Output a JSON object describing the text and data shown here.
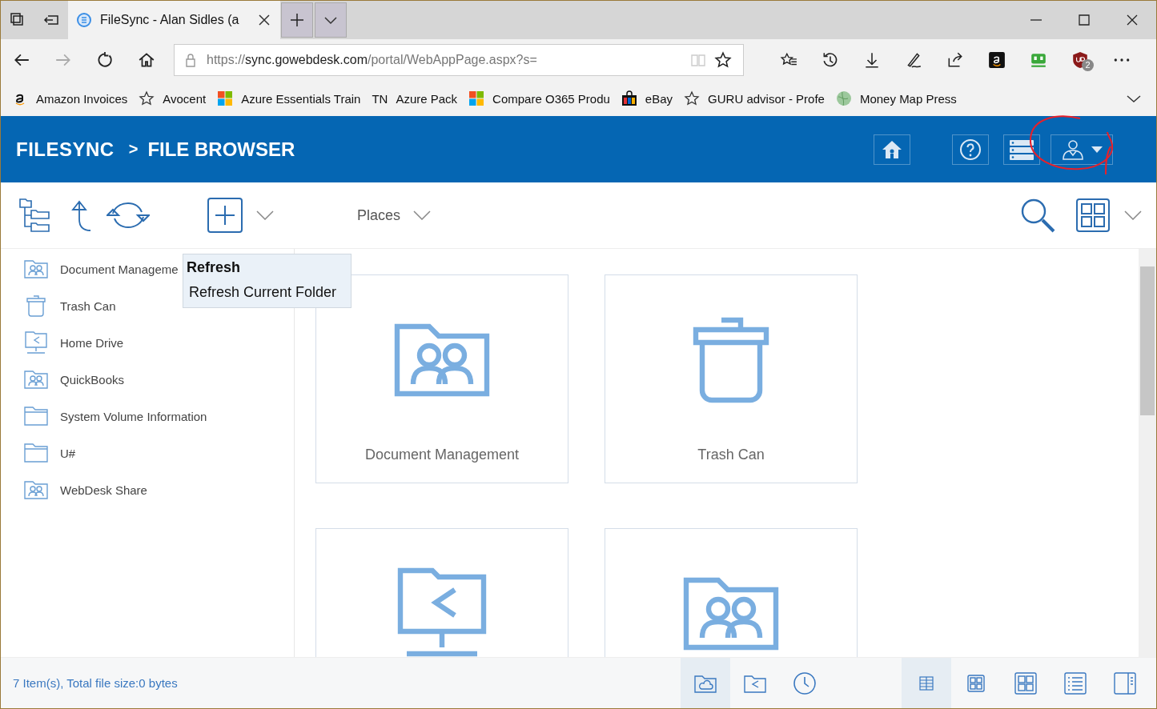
{
  "browser": {
    "tab_title": "FileSync - Alan Sidles (a",
    "url": {
      "scheme": "https://",
      "host": "sync.gowebdesk.com",
      "path": "/portal/WebAppPage.aspx?s="
    },
    "extension_badge": "2",
    "favorites": [
      {
        "kind": "amazon",
        "label": "Amazon Invoices"
      },
      {
        "kind": "star",
        "label": "Avocent"
      },
      {
        "kind": "windows",
        "label": "Azure Essentials Train"
      },
      {
        "kind": "tn",
        "label": "Azure Pack",
        "prefix": "TN"
      },
      {
        "kind": "windows",
        "label": "Compare O365 Produ"
      },
      {
        "kind": "bag",
        "label": "eBay"
      },
      {
        "kind": "star",
        "label": "GURU advisor - Profe"
      },
      {
        "kind": "globe",
        "label": "Money Map Press"
      }
    ]
  },
  "app": {
    "brand": "FILESYNC",
    "separator": ">",
    "page_title": "FILE BROWSER"
  },
  "toolbar": {
    "places": "Places"
  },
  "tooltip": {
    "title": "Refresh",
    "text": "Refresh Current Folder"
  },
  "sidebar": {
    "items": [
      {
        "kind": "shared",
        "label": "Document Manageme"
      },
      {
        "kind": "trash",
        "label": "Trash Can"
      },
      {
        "kind": "network",
        "label": "Home Drive"
      },
      {
        "kind": "shared",
        "label": "QuickBooks"
      },
      {
        "kind": "folder",
        "label": "System Volume Information"
      },
      {
        "kind": "folder",
        "label": "U#"
      },
      {
        "kind": "shared",
        "label": "WebDesk Share"
      }
    ]
  },
  "tiles": [
    {
      "kind": "shared",
      "label": "Document Management"
    },
    {
      "kind": "trash",
      "label": "Trash Can"
    },
    {
      "kind": "network"
    },
    {
      "kind": "shared"
    }
  ],
  "status_bar": {
    "summary": "7 Item(s), Total file size:0 bytes",
    "places": [
      {
        "kind": "cloud",
        "selected": true
      },
      {
        "kind": "share",
        "selected": false
      },
      {
        "kind": "recent",
        "selected": false
      }
    ],
    "views": [
      {
        "kind": "tiny",
        "selected": true
      },
      {
        "kind": "small",
        "selected": false
      },
      {
        "kind": "large",
        "selected": false
      },
      {
        "kind": "list",
        "selected": false
      },
      {
        "kind": "preview",
        "selected": false
      }
    ]
  }
}
